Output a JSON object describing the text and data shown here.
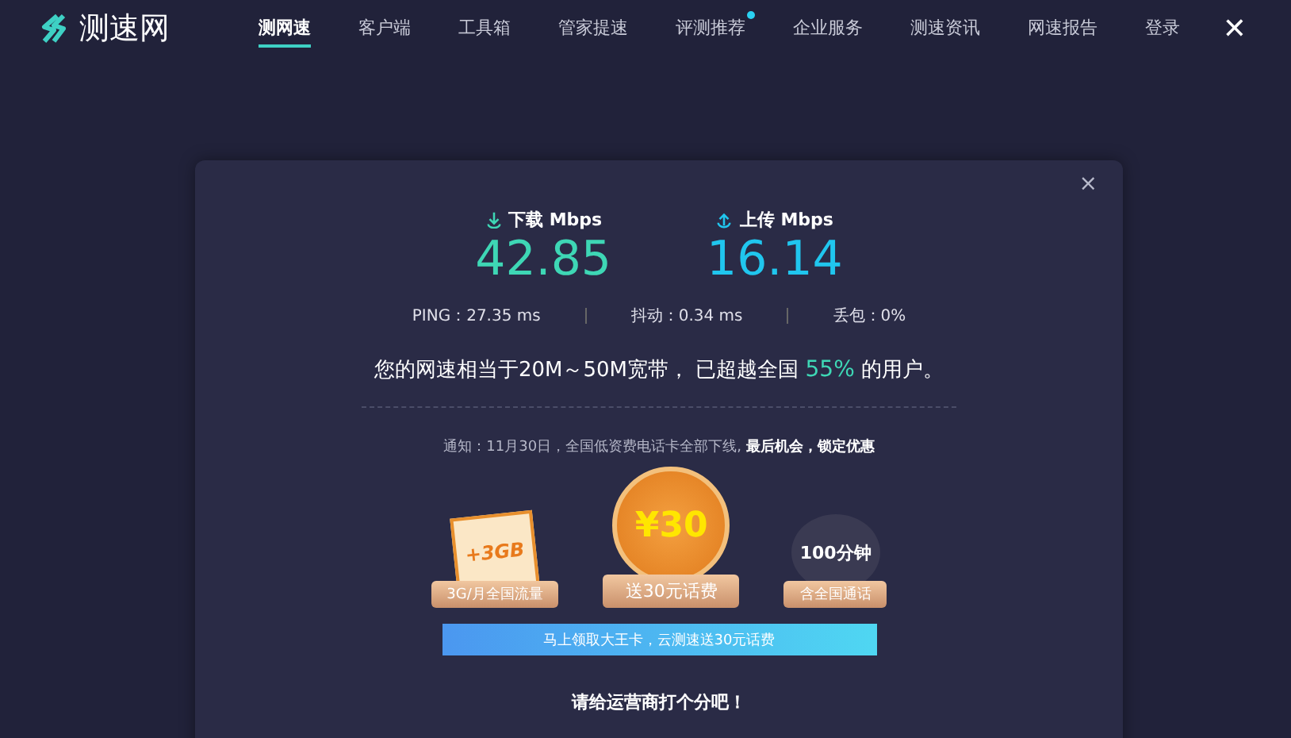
{
  "brand": {
    "name": "测速网"
  },
  "nav": [
    {
      "label": "测网速",
      "selected": true,
      "badge": false
    },
    {
      "label": "客户端",
      "selected": false,
      "badge": false
    },
    {
      "label": "工具箱",
      "selected": false,
      "badge": false
    },
    {
      "label": "管家提速",
      "selected": false,
      "badge": false
    },
    {
      "label": "评测推荐",
      "selected": false,
      "badge": true
    },
    {
      "label": "企业服务",
      "selected": false,
      "badge": false
    },
    {
      "label": "测速资讯",
      "selected": false,
      "badge": false
    },
    {
      "label": "网速报告",
      "selected": false,
      "badge": false
    },
    {
      "label": "登录",
      "selected": false,
      "badge": false
    }
  ],
  "close_symbol": "✕",
  "dialog": {
    "close_symbol": "×",
    "speeds": [
      {
        "kind": "download",
        "label": "下载 Mbps",
        "value": "42.85"
      },
      {
        "kind": "upload",
        "label": "上传 Mbps",
        "value": "16.14"
      }
    ],
    "stats": [
      "PING：27.35 ms",
      "抖动：0.34 ms",
      "丢包：0%"
    ],
    "summary": {
      "text_before": "您的网速相当于20M～50M宽带， 已超越全国",
      "highlight": "55%",
      "text_after": "的用户。"
    },
    "notice": "通知：11月30日，全国低资费电话卡全部下线, **最后机会，锁定优惠**",
    "prizes": [
      {
        "kind": "card",
        "art_text": "+3GB",
        "label": "3G/月全国流量"
      },
      {
        "kind": "coin",
        "art_text": "¥30",
        "label": "送30元话费"
      },
      {
        "kind": "map",
        "art_text": "100分钟",
        "label": "含全国通话"
      }
    ],
    "cta": "马上领取大王卡，云测速送30元话费",
    "footer": "请给运营商打个分吧！"
  }
}
